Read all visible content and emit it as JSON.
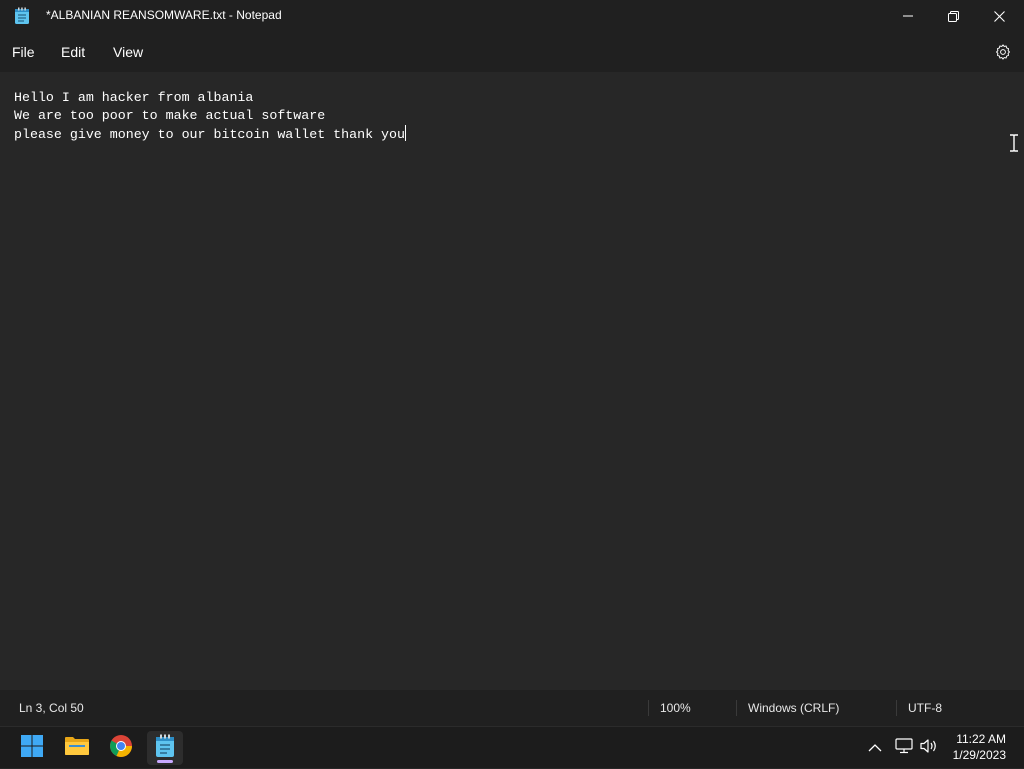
{
  "window": {
    "title": "*ALBANIAN REANSOMWARE.txt - Notepad",
    "app_icon": "notepad-icon",
    "controls": [
      "minimize-icon",
      "restore-icon",
      "close-icon"
    ]
  },
  "menu": {
    "items": [
      {
        "label": "File"
      },
      {
        "label": "Edit"
      },
      {
        "label": "View"
      }
    ],
    "settings_icon": "gear-icon"
  },
  "document": {
    "lines": [
      "Hello I am hacker from albania",
      "We are too poor to make actual software",
      "please give money to our bitcoin wallet thank you"
    ]
  },
  "status": {
    "position": "Ln 3, Col 50",
    "zoom": "100%",
    "line_ending": "Windows (CRLF)",
    "encoding": "UTF-8"
  },
  "taskbar": {
    "apps": [
      "windows-start-icon",
      "file-explorer-icon",
      "chrome-icon",
      "notepad-icon"
    ],
    "tray_icons": [
      "chevron-up-icon",
      "network-icon",
      "volume-icon"
    ],
    "time": "11:22 AM",
    "date": "1/29/2023"
  },
  "colors": {
    "titlebar": "#202020",
    "editor": "#272727",
    "taskbar": "#1c1c1c",
    "accent": "#c8a8ff"
  }
}
